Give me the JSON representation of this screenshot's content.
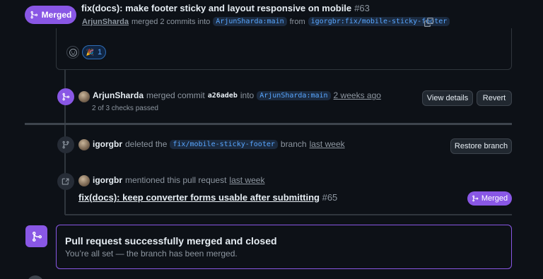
{
  "header": {
    "status_label": "Merged",
    "title": "fix(docs): make footer sticky and layout responsive on mobile",
    "number": "#63",
    "author": "ArjunSharda",
    "merged_text": "merged 2 commits into",
    "base_branch": "ArjunSharda:main",
    "from_text": "from",
    "head_branch": "igorgbr:fix/mobile-sticky-footer"
  },
  "comment": {
    "reaction_emoji": "🎉",
    "reaction_count": "1"
  },
  "merge_event": {
    "author": "ArjunSharda",
    "action": "merged commit",
    "sha": "a26adeb",
    "into_text": "into",
    "branch": "ArjunSharda:main",
    "time": "2 weeks ago",
    "checks": "2 of 3 checks passed",
    "view_details_label": "View details",
    "revert_label": "Revert"
  },
  "delete_event": {
    "author": "igorgbr",
    "action": "deleted the",
    "branch": "fix/mobile-sticky-footer",
    "branch_word": "branch",
    "time": "last week",
    "restore_label": "Restore branch"
  },
  "mention_event": {
    "author": "igorgbr",
    "action": "mentioned this pull request",
    "time": "last week",
    "ref_title": "fix(docs): keep converter forms usable after submitting",
    "ref_number": "#65",
    "ref_status": "Merged"
  },
  "merge_panel": {
    "title": "Pull request successfully merged and closed",
    "description": "You’re all set — the branch has been merged."
  },
  "colors": {
    "background": "#0d1117",
    "merged_purple": "#8957e5",
    "link_blue": "#58a6ff",
    "muted": "#8d96a0"
  }
}
